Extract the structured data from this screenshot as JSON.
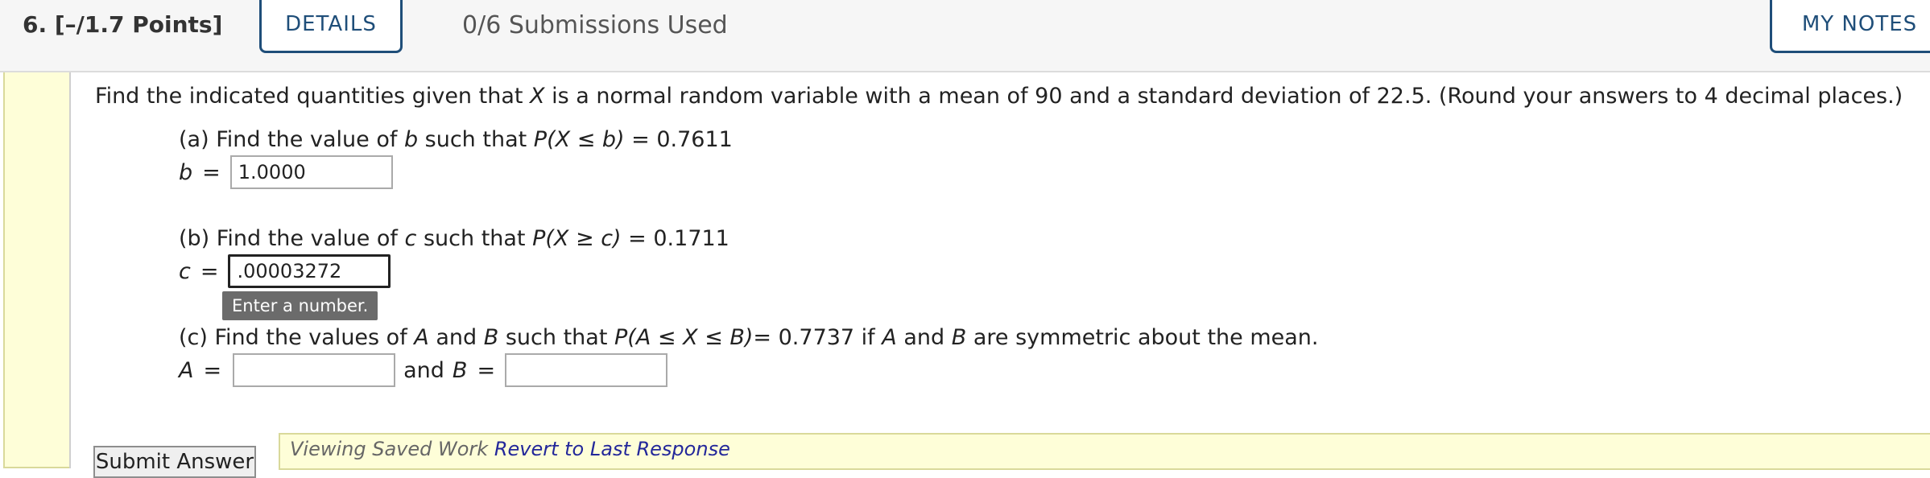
{
  "header": {
    "question_number": "6.",
    "points": "[–/1.7 Points]",
    "details_label": "DETAILS",
    "submissions": "0/6 Submissions Used",
    "my_notes_label": "MY NOTES"
  },
  "question": {
    "prompt_pre": "Find the indicated quantities given that ",
    "prompt_var": "X",
    "prompt_post": " is a normal random variable with a mean of 90 and a standard deviation of 22.5. (Round your answers to 4 decimal places.)",
    "part_a": {
      "text_1": "(a) Find the value of ",
      "var_1": "b",
      "text_2": " such that ",
      "expr": "P(X ≤ b)",
      "text_3": " = 0.7611",
      "answer_label": "b",
      "eq": "=",
      "answer_value": "1.0000"
    },
    "part_b": {
      "text_1": "(b) Find the value of ",
      "var_1": "c",
      "text_2": " such that ",
      "expr": "P(X ≥ c)",
      "text_3": " = 0.1711",
      "answer_label": "c",
      "eq": "=",
      "answer_value": ".00003272",
      "tooltip": "Enter a number."
    },
    "part_c": {
      "text_1": "(c) Find the values of ",
      "var_1": "A",
      "text_2": " and ",
      "var_2": "B",
      "text_3": " such that ",
      "expr": "P(A ≤ X ≤ B)",
      "text_4": "= 0.7737 if ",
      "var_3": "A",
      "text_5": " and ",
      "var_4": "B",
      "text_6": " are symmetric about the mean.",
      "label_a": "A",
      "eq": "=",
      "and_text": "and",
      "label_b": "B",
      "eq_b": "=",
      "value_a": "",
      "value_b": ""
    }
  },
  "footer": {
    "submit_label": "Submit Answer",
    "saved_text": "Viewing Saved Work",
    "revert_link": "Revert to Last Response"
  }
}
